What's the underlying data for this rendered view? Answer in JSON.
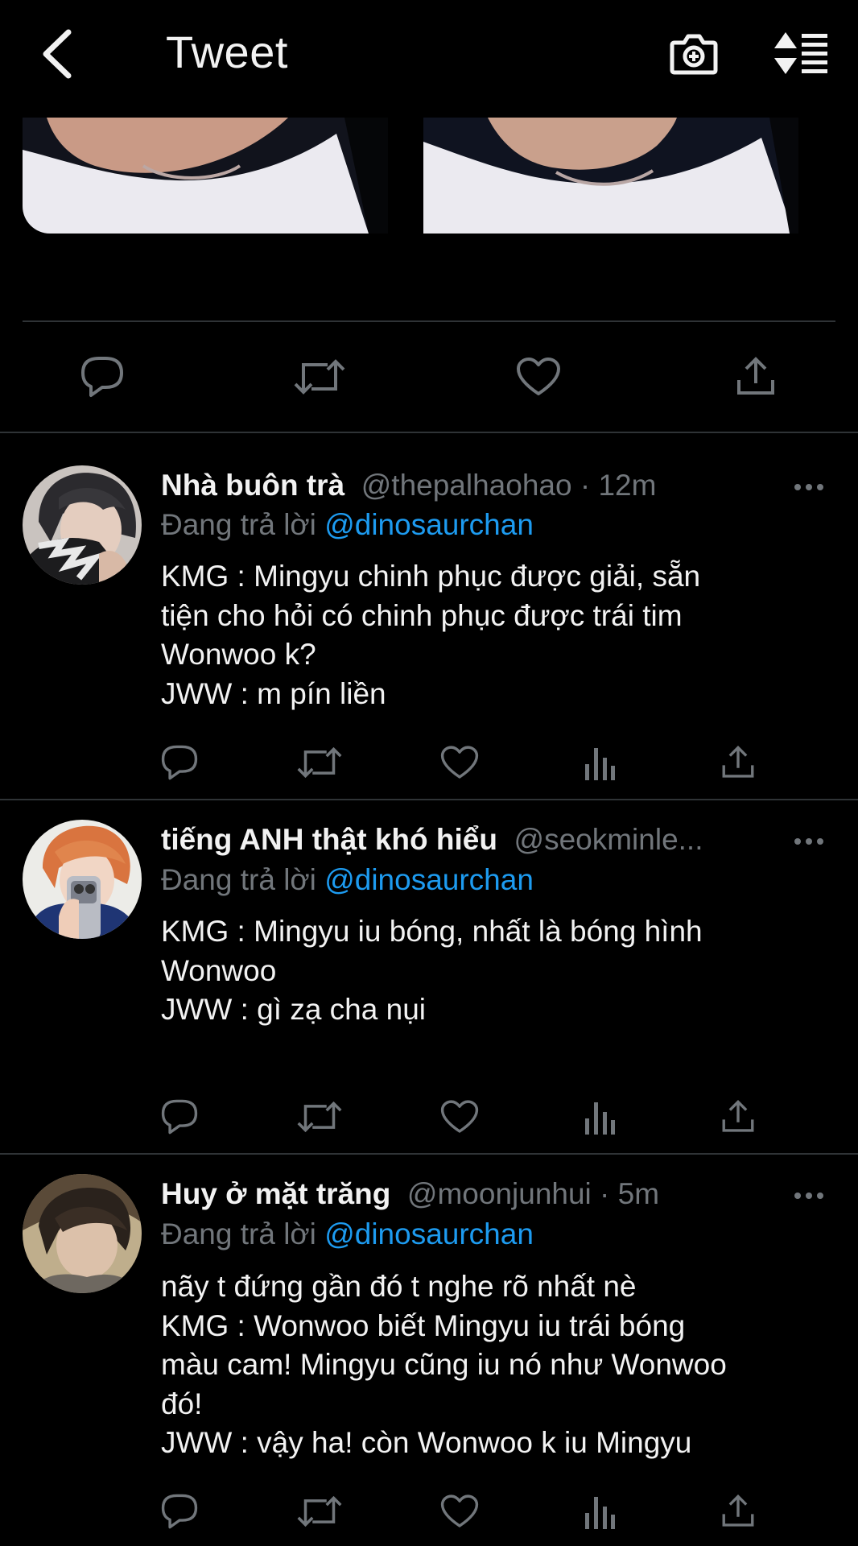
{
  "header": {
    "title": "Tweet",
    "back_icon": "chevron-left-icon",
    "camera_icon": "camera-plus-icon",
    "sort_icon": "sort-list-icon"
  },
  "colors": {
    "background": "#000000",
    "text": "#f2f2f2",
    "secondary": "#71767b",
    "link": "#1d9bf0",
    "divider": "#2f3336"
  },
  "main_tweet": {
    "actions": [
      "reply-icon",
      "retweet-icon",
      "like-icon",
      "share-icon"
    ]
  },
  "replies": [
    {
      "name": "Nhà buôn trà",
      "handle": "@thepalhaohao",
      "separator": " · ",
      "time": "12m",
      "reply_prefix": "Đang trả lời ",
      "reply_to": "@dinosaurchan",
      "lines": [
        "KMG : Mingyu chinh phục được giải, sẵn",
        "tiện cho hỏi có chinh phục được trái tim",
        "Wonwoo k?",
        "JWW : m pín liền"
      ]
    },
    {
      "name": "tiếng ANH thật khó hiểu",
      "handle": "@seokminle...",
      "separator": "",
      "time": "",
      "reply_prefix": "Đang trả lời ",
      "reply_to": "@dinosaurchan",
      "lines": [
        "KMG : Mingyu iu bóng, nhất là bóng hình",
        "Wonwoo",
        "JWW : gì zạ cha nụi"
      ]
    },
    {
      "name": "Huy ở mặt trăng",
      "handle": "@moonjunhui",
      "separator": " · ",
      "time": "5m",
      "reply_prefix": "Đang trả lời ",
      "reply_to": "@dinosaurchan",
      "lines": [
        "nãy t đứng gần đó t nghe rõ nhất nè",
        "KMG : Wonwoo biết Mingyu iu trái bóng",
        "màu cam! Mingyu cũng iu nó như Wonwoo",
        "đó!",
        "JWW : vậy ha! còn Wonwoo k iu Mingyu"
      ]
    }
  ]
}
